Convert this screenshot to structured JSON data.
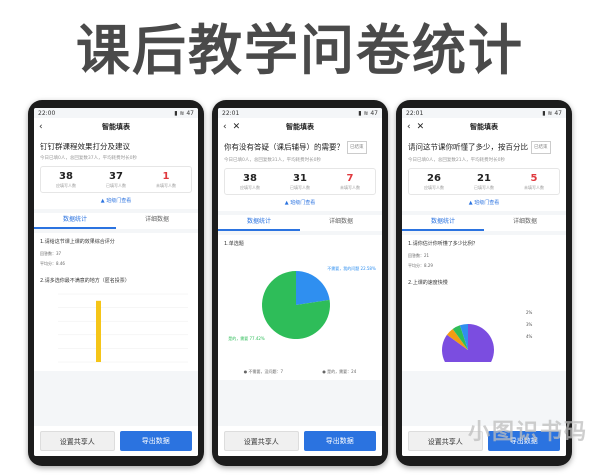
{
  "headline": "课后教学问卷统计",
  "phones": [
    {
      "status": {
        "time": "22:00",
        "icons": "▮ ≋ 47"
      },
      "nav_title": "智能填表",
      "question": "钉钉群课程效果打分及建议",
      "tag": "",
      "summary": "今日已填0人，总回复数37人，平均耗费时长0秒",
      "stats": [
        {
          "num": "38",
          "label": "应填写人数"
        },
        {
          "num": "37",
          "label": "已填写人数"
        },
        {
          "num": "1",
          "label": "未填写人数"
        }
      ],
      "dir_link": "班级门查看",
      "tabs": [
        "数据统计",
        "详细数据"
      ],
      "sections": [
        {
          "title": "1.请给这节课上课的效果综合评分",
          "lines": [
            "回答数：37",
            "平均分：8.46"
          ]
        },
        {
          "title": "2.请多选你最不满意的地方（匿名投票）",
          "lines": []
        }
      ],
      "chart_data": {
        "type": "bar",
        "categories": [
          ""
        ],
        "values": [
          9
        ],
        "ylim": [
          0,
          10
        ]
      },
      "buttons": {
        "share": "设置共享人",
        "export": "导出数据"
      }
    },
    {
      "status": {
        "time": "22:01",
        "icons": "▮ ≋ 47"
      },
      "nav_title": "智能填表",
      "question": "你有没有答疑（课后辅导）的需要？",
      "tag": "已结束",
      "summary": "今日已填0人，总回复数31人，平均耗费时长0秒",
      "stats": [
        {
          "num": "38",
          "label": "应填写人数"
        },
        {
          "num": "31",
          "label": "已填写人数"
        },
        {
          "num": "7",
          "label": "未填写人数"
        }
      ],
      "dir_link": "班级门查看",
      "tabs": [
        "数据统计",
        "详细数据"
      ],
      "sections": [
        {
          "title": "1.单选题",
          "lines": []
        }
      ],
      "chart_data": {
        "type": "pie",
        "categories": [
          "不需要，没问题",
          "是的，需要"
        ],
        "values": [
          22.58,
          77.42
        ],
        "slice_labels": [
          "不需要，我的问题 22.58%",
          "是的，需要 77.42%"
        ],
        "legend": [
          "● 不需要，没问题：7",
          "● 是的，需要：24"
        ]
      },
      "buttons": {
        "share": "设置共享人",
        "export": "导出数据"
      }
    },
    {
      "status": {
        "time": "22:01",
        "icons": "▮ ≋ 47"
      },
      "nav_title": "智能填表",
      "question": "请问这节课你听懂了多少，按百分比",
      "tag": "已结束",
      "summary": "今日已填0人，总回复数21人，平均耗费时长0秒",
      "stats": [
        {
          "num": "26",
          "label": "应填写人数"
        },
        {
          "num": "21",
          "label": "已填写人数"
        },
        {
          "num": "5",
          "label": "未填写人数"
        }
      ],
      "dir_link": "班级门查看",
      "tabs": [
        "数据统计",
        "详细数据"
      ],
      "sections": [
        {
          "title": "1.请你估计你听懂了多少比例？",
          "lines": [
            "回答数：21",
            "平均分：8.29"
          ]
        },
        {
          "title": "2.上课的速度快慢",
          "lines": []
        }
      ],
      "chart_data": {
        "type": "pie",
        "categories": [
          "",
          "",
          "",
          ""
        ],
        "values": [
          85,
          5,
          5,
          5
        ],
        "slice_labels": [
          "",
          "2%",
          "3%",
          "4%"
        ]
      },
      "buttons": {
        "share": "设置共享人",
        "export": "导出数据"
      }
    }
  ],
  "watermark": "小图识书码",
  "colors": {
    "accent": "#2b73e0",
    "bar": "#f5c518",
    "pie_green": "#2ebd59",
    "pie_blue": "#2f8ff0",
    "pie_purple": "#7b4de0",
    "red": "#e0393e"
  }
}
